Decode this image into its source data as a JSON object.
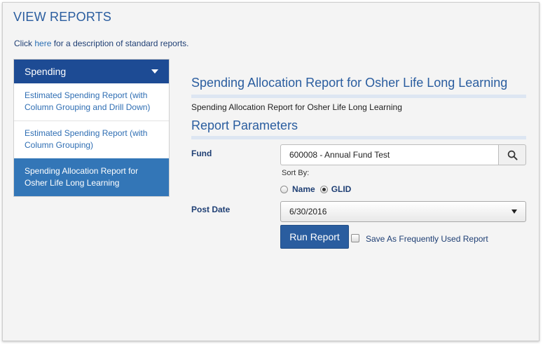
{
  "page": {
    "title": "VIEW REPORTS",
    "intro_prefix": "Click",
    "intro_link": "here",
    "intro_suffix": "for a description of standard reports."
  },
  "sidebar": {
    "header": "Spending",
    "items": [
      {
        "label": "Estimated Spending Report (with Column Grouping and Drill Down)",
        "active": false
      },
      {
        "label": "Estimated Spending Report (with Column Grouping)",
        "active": false
      },
      {
        "label": "Spending Allocation Report for Osher Life Long Learning",
        "active": true
      }
    ]
  },
  "report": {
    "title": "Spending Allocation Report for Osher Life Long Learning",
    "description": "Spending Allocation Report for Osher Life Long Learning"
  },
  "params": {
    "title": "Report Parameters",
    "fund_label": "Fund",
    "fund_value": "600008 - Annual Fund Test",
    "sort_by_label": "Sort By:",
    "sort_options": [
      {
        "label": "Name",
        "selected": false
      },
      {
        "label": "GLID",
        "selected": true
      }
    ],
    "post_date_label": "Post Date",
    "post_date_value": "6/30/2016",
    "run_button": "Run Report",
    "save_label": "Save As Frequently Used Report",
    "save_checked": false
  },
  "icons": {
    "search": "search-icon",
    "caret": "chevron-down-icon"
  },
  "colors": {
    "primary": "#2a5d9f",
    "sidebar_header": "#1d4b94",
    "sidebar_active": "#3376b7",
    "link": "#2a6fb4"
  }
}
